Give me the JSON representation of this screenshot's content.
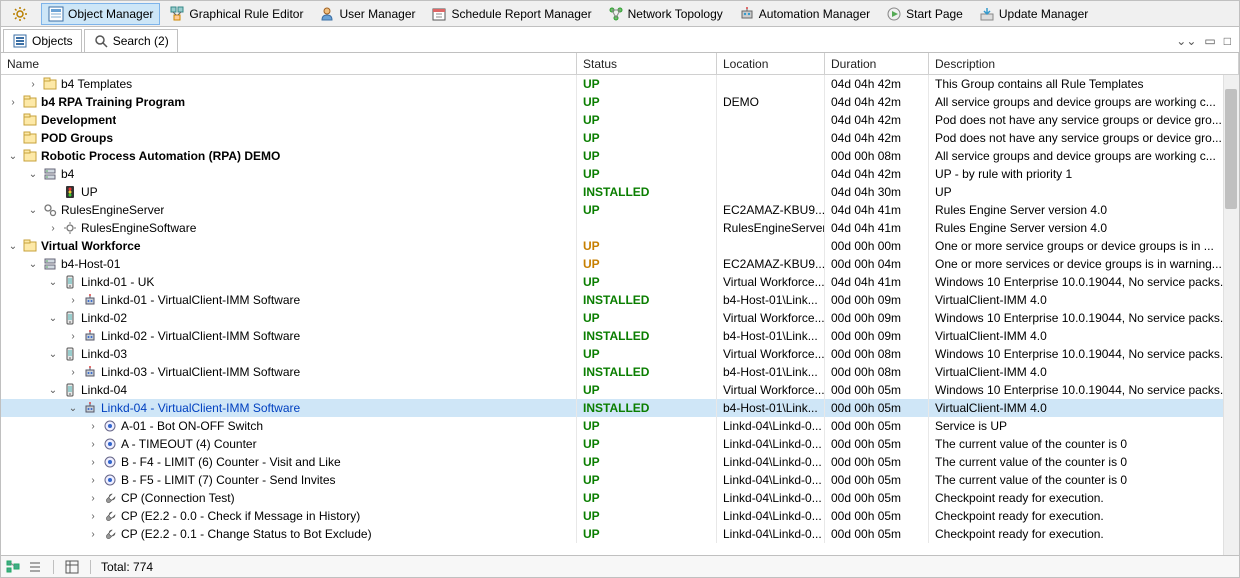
{
  "toolbar": [
    {
      "key": "gear",
      "label": ""
    },
    {
      "key": "object_manager",
      "label": "Object Manager",
      "active": true
    },
    {
      "key": "rule_editor",
      "label": "Graphical Rule Editor"
    },
    {
      "key": "user_manager",
      "label": "User Manager"
    },
    {
      "key": "schedule_report",
      "label": "Schedule Report Manager"
    },
    {
      "key": "network_topology",
      "label": "Network Topology"
    },
    {
      "key": "automation_manager",
      "label": "Automation Manager"
    },
    {
      "key": "start_page",
      "label": "Start Page"
    },
    {
      "key": "update_manager",
      "label": "Update Manager"
    }
  ],
  "tabs": {
    "objects": "Objects",
    "search": "Search (2)"
  },
  "columns": {
    "name": "Name",
    "status": "Status",
    "location": "Location",
    "duration": "Duration",
    "description": "Description"
  },
  "rows": [
    {
      "indent": 1,
      "exp": ">",
      "icon": "group",
      "bold": false,
      "label": "b4 Templates",
      "status": "UP",
      "statusClass": "status-up",
      "location": "",
      "duration": "04d  04h  42m",
      "desc": "This Group contains all Rule Templates"
    },
    {
      "indent": 0,
      "exp": ">",
      "icon": "group",
      "bold": true,
      "label": "b4 RPA Training Program",
      "status": "UP",
      "statusClass": "status-up",
      "location": "DEMO",
      "duration": "04d  04h  42m",
      "desc": "All service groups and device groups are working c..."
    },
    {
      "indent": 0,
      "exp": "",
      "icon": "group",
      "bold": true,
      "label": "Development",
      "status": "UP",
      "statusClass": "status-up",
      "location": "",
      "duration": "04d  04h  42m",
      "desc": "Pod does not have any service groups or device gro..."
    },
    {
      "indent": 0,
      "exp": "",
      "icon": "group",
      "bold": true,
      "label": "POD Groups",
      "status": "UP",
      "statusClass": "status-up",
      "location": "",
      "duration": "04d  04h  42m",
      "desc": "Pod does not have any service groups or device gro..."
    },
    {
      "indent": 0,
      "exp": "v",
      "icon": "group",
      "bold": true,
      "label": "Robotic Process Automation (RPA) DEMO",
      "status": "UP",
      "statusClass": "status-up",
      "location": "",
      "duration": "00d  00h  08m",
      "desc": "All service groups and device groups are working c..."
    },
    {
      "indent": 1,
      "exp": "v",
      "icon": "server",
      "bold": false,
      "label": "b4",
      "status": "UP",
      "statusClass": "status-up",
      "location": "",
      "duration": "04d  04h  42m",
      "desc": "UP - by rule with priority 1"
    },
    {
      "indent": 2,
      "exp": "",
      "icon": "light",
      "bold": false,
      "label": "UP",
      "status": "INSTALLED",
      "statusClass": "status-installed",
      "location": "",
      "duration": "04d  04h  30m",
      "desc": "UP"
    },
    {
      "indent": 1,
      "exp": "v",
      "icon": "gears",
      "bold": false,
      "label": "RulesEngineServer",
      "status": "UP",
      "statusClass": "status-up",
      "location": "EC2AMAZ-KBU9...",
      "duration": "04d  04h  41m",
      "desc": "Rules Engine Server version 4.0"
    },
    {
      "indent": 2,
      "exp": ">",
      "icon": "gear",
      "bold": false,
      "label": "RulesEngineSoftware",
      "status": "",
      "statusClass": "",
      "location": "RulesEngineServer",
      "duration": "04d  04h  41m",
      "desc": "Rules Engine Server version 4.0"
    },
    {
      "indent": 0,
      "exp": "v",
      "icon": "group",
      "bold": true,
      "label": "Virtual Workforce",
      "status": "UP",
      "statusClass": "status-up-amber",
      "location": "",
      "duration": "00d  00h  00m",
      "desc": "One or more service groups or device groups is in ..."
    },
    {
      "indent": 1,
      "exp": "v",
      "icon": "server",
      "bold": false,
      "label": "b4-Host-01",
      "status": "UP",
      "statusClass": "status-up-amber",
      "location": "EC2AMAZ-KBU9...",
      "duration": "00d  00h  04m",
      "desc": "One or more services or device groups is in warning..."
    },
    {
      "indent": 2,
      "exp": "v",
      "icon": "device",
      "bold": false,
      "label": "Linkd-01 - UK",
      "status": "UP",
      "statusClass": "status-up",
      "location": "Virtual Workforce...",
      "duration": "04d  04h  41m",
      "desc": "Windows 10 Enterprise 10.0.19044, No service packs..."
    },
    {
      "indent": 3,
      "exp": ">",
      "icon": "robot",
      "bold": false,
      "label": "Linkd-01 - VirtualClient-IMM Software",
      "status": "INSTALLED",
      "statusClass": "status-installed",
      "location": "b4-Host-01\\Link...",
      "duration": "00d  00h  09m",
      "desc": "VirtualClient-IMM 4.0"
    },
    {
      "indent": 2,
      "exp": "v",
      "icon": "device",
      "bold": false,
      "label": "Linkd-02",
      "status": "UP",
      "statusClass": "status-up",
      "location": "Virtual Workforce...",
      "duration": "00d  00h  09m",
      "desc": "Windows 10 Enterprise 10.0.19044, No service packs..."
    },
    {
      "indent": 3,
      "exp": ">",
      "icon": "robot",
      "bold": false,
      "label": "Linkd-02 - VirtualClient-IMM Software",
      "status": "INSTALLED",
      "statusClass": "status-installed",
      "location": "b4-Host-01\\Link...",
      "duration": "00d  00h  09m",
      "desc": "VirtualClient-IMM 4.0"
    },
    {
      "indent": 2,
      "exp": "v",
      "icon": "device",
      "bold": false,
      "label": "Linkd-03",
      "status": "UP",
      "statusClass": "status-up",
      "location": "Virtual Workforce...",
      "duration": "00d  00h  08m",
      "desc": "Windows 10 Enterprise 10.0.19044, No service packs..."
    },
    {
      "indent": 3,
      "exp": ">",
      "icon": "robot",
      "bold": false,
      "label": "Linkd-03 - VirtualClient-IMM Software",
      "status": "INSTALLED",
      "statusClass": "status-installed",
      "location": "b4-Host-01\\Link...",
      "duration": "00d  00h  08m",
      "desc": "VirtualClient-IMM 4.0"
    },
    {
      "indent": 2,
      "exp": "v",
      "icon": "device",
      "bold": false,
      "label": "Linkd-04",
      "status": "UP",
      "statusClass": "status-up",
      "location": "Virtual Workforce...",
      "duration": "00d  00h  05m",
      "desc": "Windows 10 Enterprise 10.0.19044, No service packs..."
    },
    {
      "indent": 3,
      "exp": "v",
      "icon": "robot",
      "bold": false,
      "blue": true,
      "hili": true,
      "label": "Linkd-04 - VirtualClient-IMM Software",
      "status": "INSTALLED",
      "statusClass": "status-installed",
      "location": "b4-Host-01\\Link...",
      "duration": "00d  00h  05m",
      "desc": "VirtualClient-IMM 4.0"
    },
    {
      "indent": 4,
      "exp": ">",
      "icon": "badge",
      "bold": false,
      "label": "A-01 - Bot ON-OFF Switch",
      "status": "UP",
      "statusClass": "status-up",
      "location": "Linkd-04\\Linkd-0...",
      "duration": "00d  00h  05m",
      "desc": "Service is UP"
    },
    {
      "indent": 4,
      "exp": ">",
      "icon": "badge",
      "bold": false,
      "label": "A - TIMEOUT (4) Counter",
      "status": "UP",
      "statusClass": "status-up",
      "location": "Linkd-04\\Linkd-0...",
      "duration": "00d  00h  05m",
      "desc": "The current value of the counter is 0"
    },
    {
      "indent": 4,
      "exp": ">",
      "icon": "badge",
      "bold": false,
      "label": "B - F4 - LIMIT (6) Counter - Visit and Like",
      "status": "UP",
      "statusClass": "status-up",
      "location": "Linkd-04\\Linkd-0...",
      "duration": "00d  00h  05m",
      "desc": "The current value of the counter is 0"
    },
    {
      "indent": 4,
      "exp": ">",
      "icon": "badge",
      "bold": false,
      "label": "B - F5 - LIMIT (7) Counter - Send Invites",
      "status": "UP",
      "statusClass": "status-up",
      "location": "Linkd-04\\Linkd-0...",
      "duration": "00d  00h  05m",
      "desc": "The current value of the counter is 0"
    },
    {
      "indent": 4,
      "exp": ">",
      "icon": "wrench",
      "bold": false,
      "label": "CP (Connection Test)",
      "status": "UP",
      "statusClass": "status-up",
      "location": "Linkd-04\\Linkd-0...",
      "duration": "00d  00h  05m",
      "desc": "Checkpoint ready for execution."
    },
    {
      "indent": 4,
      "exp": ">",
      "icon": "wrench",
      "bold": false,
      "label": "CP (E2.2 - 0.0 - Check if Message in History)",
      "status": "UP",
      "statusClass": "status-up",
      "location": "Linkd-04\\Linkd-0...",
      "duration": "00d  00h  05m",
      "desc": "Checkpoint ready for execution."
    },
    {
      "indent": 4,
      "exp": ">",
      "icon": "wrench",
      "bold": false,
      "label": "CP (E2.2 - 0.1 - Change Status to Bot Exclude)",
      "status": "UP",
      "statusClass": "status-up",
      "location": "Linkd-04\\Linkd-0...",
      "duration": "00d  00h  05m",
      "desc": "Checkpoint ready for execution."
    }
  ],
  "statusbar": {
    "total_label": "Total: 774"
  }
}
